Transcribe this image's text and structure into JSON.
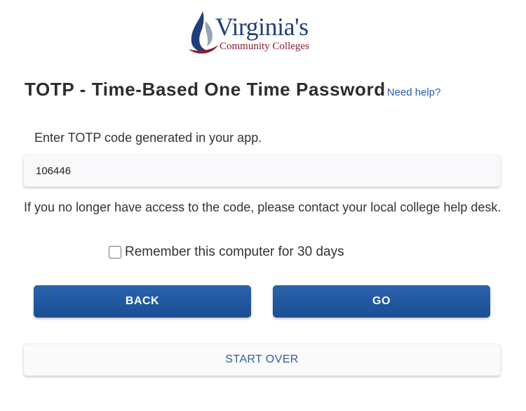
{
  "logo": {
    "wordmark": "Virginia's",
    "subtitle": "Community Colleges"
  },
  "heading": {
    "title": "TOTP - Time-Based One Time Password",
    "need_help_link": "Need help?"
  },
  "form": {
    "instruction": "Enter TOTP code generated in your app.",
    "code_value": "106446",
    "help_text": "If you no longer have access to the code, please contact your local college help desk.",
    "remember_label": "Remember this computer for 30 days",
    "remember_checked": false
  },
  "buttons": {
    "back_label": "BACK",
    "go_label": "GO",
    "start_over_label": "START OVER"
  },
  "colors": {
    "primary_button": "#1f579f",
    "link": "#2a5db0",
    "logo_blue": "#1f3f7a",
    "logo_red": "#8a1e2d"
  }
}
